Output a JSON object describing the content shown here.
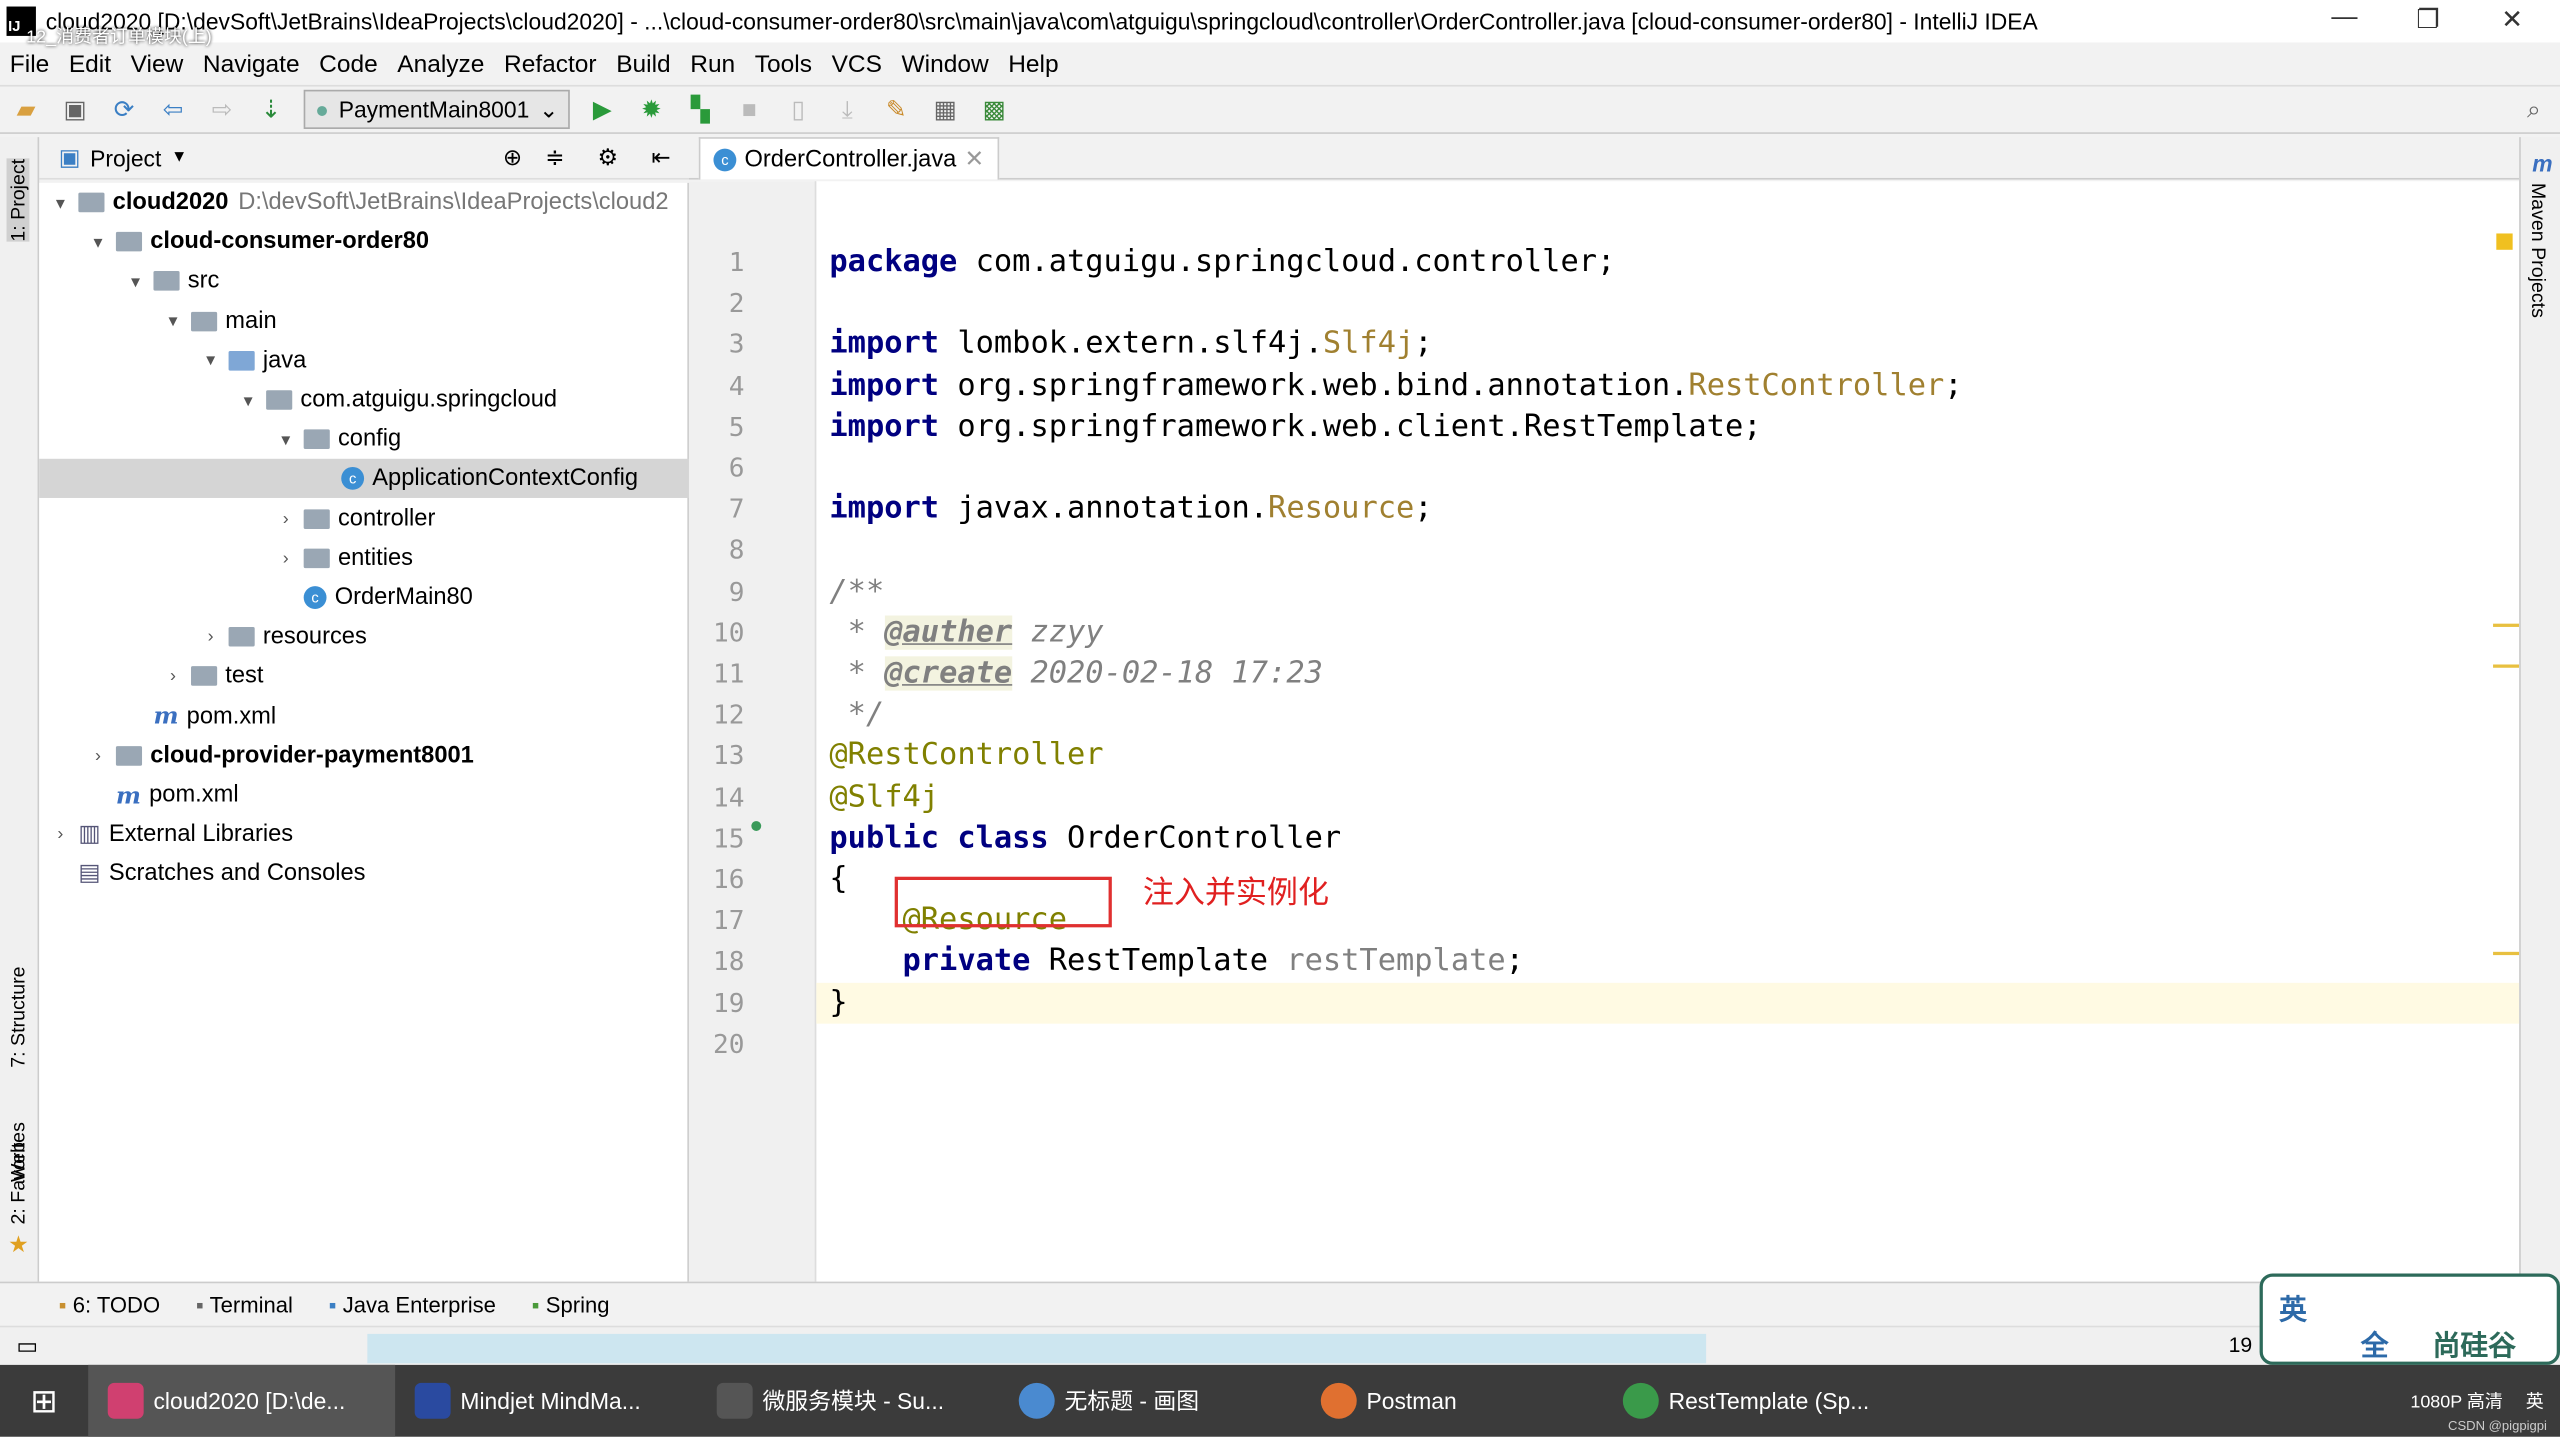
{
  "window": {
    "title": "cloud2020 [D:\\devSoft\\JetBrains\\IdeaProjects\\cloud2020] - ...\\cloud-consumer-order80\\src\\main\\java\\com\\atguigu\\springcloud\\controller\\OrderController.java [cloud-consumer-order80] - IntelliJ IDEA",
    "overlay": "12_消费者订单模块(上)"
  },
  "menu": [
    "File",
    "Edit",
    "View",
    "Navigate",
    "Code",
    "Analyze",
    "Refactor",
    "Build",
    "Run",
    "Tools",
    "VCS",
    "Window",
    "Help"
  ],
  "toolbar": {
    "run_config": "PaymentMain8001"
  },
  "left_strip": {
    "project": "1: Project",
    "structure": "7: Structure",
    "web": "Web",
    "favorites": "2: Favorites"
  },
  "right_strip": {
    "maven": "Maven Projects"
  },
  "project_panel": {
    "title": "Project",
    "tree": [
      {
        "label": "cloud2020",
        "path": "D:\\devSoft\\JetBrains\\IdeaProjects\\cloud2",
        "depth": 0,
        "arrow": "▾",
        "icon": "module",
        "bold": true
      },
      {
        "label": "cloud-consumer-order80",
        "depth": 1,
        "arrow": "▾",
        "icon": "module",
        "bold": true
      },
      {
        "label": "src",
        "depth": 2,
        "arrow": "▾",
        "icon": "folder"
      },
      {
        "label": "main",
        "depth": 3,
        "arrow": "▾",
        "icon": "folder"
      },
      {
        "label": "java",
        "depth": 4,
        "arrow": "▾",
        "icon": "src"
      },
      {
        "label": "com.atguigu.springcloud",
        "depth": 5,
        "arrow": "▾",
        "icon": "folder"
      },
      {
        "label": "config",
        "depth": 6,
        "arrow": "▾",
        "icon": "folder"
      },
      {
        "label": "ApplicationContextConfig",
        "depth": 7,
        "arrow": "",
        "icon": "class",
        "selected": true
      },
      {
        "label": "controller",
        "depth": 6,
        "arrow": "›",
        "icon": "folder"
      },
      {
        "label": "entities",
        "depth": 6,
        "arrow": "›",
        "icon": "folder"
      },
      {
        "label": "OrderMain80",
        "depth": 6,
        "arrow": "",
        "icon": "class"
      },
      {
        "label": "resources",
        "depth": 4,
        "arrow": "›",
        "icon": "folder"
      },
      {
        "label": "test",
        "depth": 3,
        "arrow": "›",
        "icon": "folder"
      },
      {
        "label": "pom.xml",
        "depth": 2,
        "arrow": "",
        "icon": "maven"
      },
      {
        "label": "cloud-provider-payment8001",
        "depth": 1,
        "arrow": "›",
        "icon": "module",
        "bold": true
      },
      {
        "label": "pom.xml",
        "depth": 1,
        "arrow": "",
        "icon": "maven"
      },
      {
        "label": "External Libraries",
        "depth": 0,
        "arrow": "›",
        "icon": "lib"
      },
      {
        "label": "Scratches and Consoles",
        "depth": 0,
        "arrow": "",
        "icon": "scratch"
      }
    ]
  },
  "editor": {
    "tab": "OrderController.java",
    "current_line": 19,
    "lines": [
      [
        [
          "package ",
          "kw"
        ],
        [
          "com.atguigu.springcloud.controller;",
          ""
        ]
      ],
      [],
      [
        [
          "import ",
          "kw"
        ],
        [
          "lombok.extern.slf4j.",
          ""
        ],
        [
          "Slf4j",
          "unused"
        ],
        [
          ";",
          ""
        ]
      ],
      [
        [
          "import ",
          "kw"
        ],
        [
          "org.springframework.web.bind.annotation.",
          ""
        ],
        [
          "RestController",
          "unused"
        ],
        [
          ";",
          ""
        ]
      ],
      [
        [
          "import ",
          "kw"
        ],
        [
          "org.springframework.web.client.RestTemplate;",
          ""
        ]
      ],
      [],
      [
        [
          "import ",
          "kw"
        ],
        [
          "javax.annotation.",
          ""
        ],
        [
          "Resource",
          "unused"
        ],
        [
          ";",
          ""
        ]
      ],
      [],
      [
        [
          "/**",
          "cmt"
        ]
      ],
      [
        [
          " * ",
          "cmt"
        ],
        [
          "@auther",
          "tag"
        ],
        [
          " zzyy",
          "cmt"
        ]
      ],
      [
        [
          " * ",
          "cmt"
        ],
        [
          "@create",
          "tag"
        ],
        [
          " 2020-02-18 17:23",
          "cmt"
        ]
      ],
      [
        [
          " */",
          "cmt"
        ]
      ],
      [
        [
          "@RestController",
          "ann"
        ]
      ],
      [
        [
          "@Slf4j",
          "ann"
        ]
      ],
      [
        [
          "public class ",
          "kw"
        ],
        [
          "OrderController",
          ""
        ]
      ],
      [
        [
          "{",
          ""
        ]
      ],
      [
        [
          "    ",
          ""
        ],
        [
          "@Resource",
          "ann"
        ]
      ],
      [
        [
          "    ",
          ""
        ],
        [
          "private ",
          "kw"
        ],
        [
          "RestTemplate ",
          ""
        ],
        [
          "restTemplate",
          "fld"
        ],
        [
          ";",
          ""
        ]
      ],
      [
        [
          "}",
          ""
        ]
      ],
      []
    ],
    "annotation_note": "注入并实例化"
  },
  "bottom_tools": [
    "6: TODO",
    "Terminal",
    "Java Enterprise",
    "Spring"
  ],
  "status": {
    "line": "19"
  },
  "ime": {
    "lang": "英",
    "mode": "全",
    "brand": "尚硅谷"
  },
  "taskbar": {
    "items": [
      "cloud2020 [D:\\de...",
      "Mindjet MindMa...",
      "微服务模块 - Su...",
      "无标题 - 画图",
      "Postman",
      "RestTemplate (Sp..."
    ],
    "tray": [
      "1080P 高清",
      "英"
    ],
    "watermark": "CSDN @pigpigpi"
  }
}
